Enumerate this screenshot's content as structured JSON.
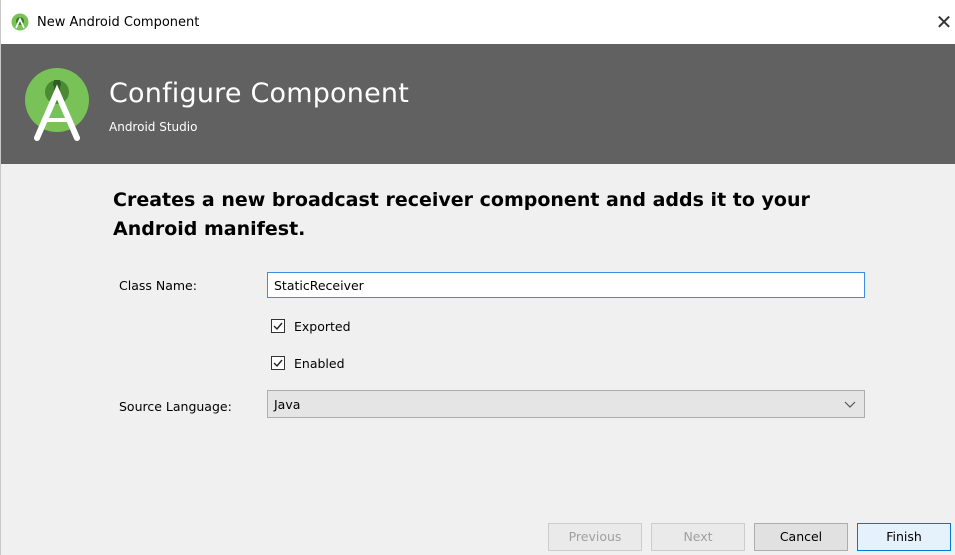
{
  "window": {
    "title": "New Android Component",
    "close_glyph": "✕"
  },
  "banner": {
    "heading": "Configure Component",
    "subheading": "Android Studio"
  },
  "content": {
    "description": "Creates a new broadcast receiver component and adds it to your Android manifest.",
    "class_name": {
      "label": "Class Name:",
      "value": "StaticReceiver"
    },
    "exported": {
      "label": "Exported",
      "checked": true
    },
    "enabled": {
      "label": "Enabled",
      "checked": true
    },
    "source_language": {
      "label": "Source Language:",
      "value": "Java"
    }
  },
  "footer": {
    "previous_label": "Previous",
    "next_label": "Next",
    "cancel_label": "Cancel",
    "finish_label": "Finish"
  },
  "colors": {
    "banner_bg": "#616161",
    "android_green": "#78c257",
    "focus_blue": "#3c8dde"
  },
  "icons": {
    "app": "android-studio-icon",
    "logo": "android-studio-logo",
    "close": "close-icon",
    "check": "checkmark-icon",
    "dropdown": "chevron-down-icon"
  }
}
